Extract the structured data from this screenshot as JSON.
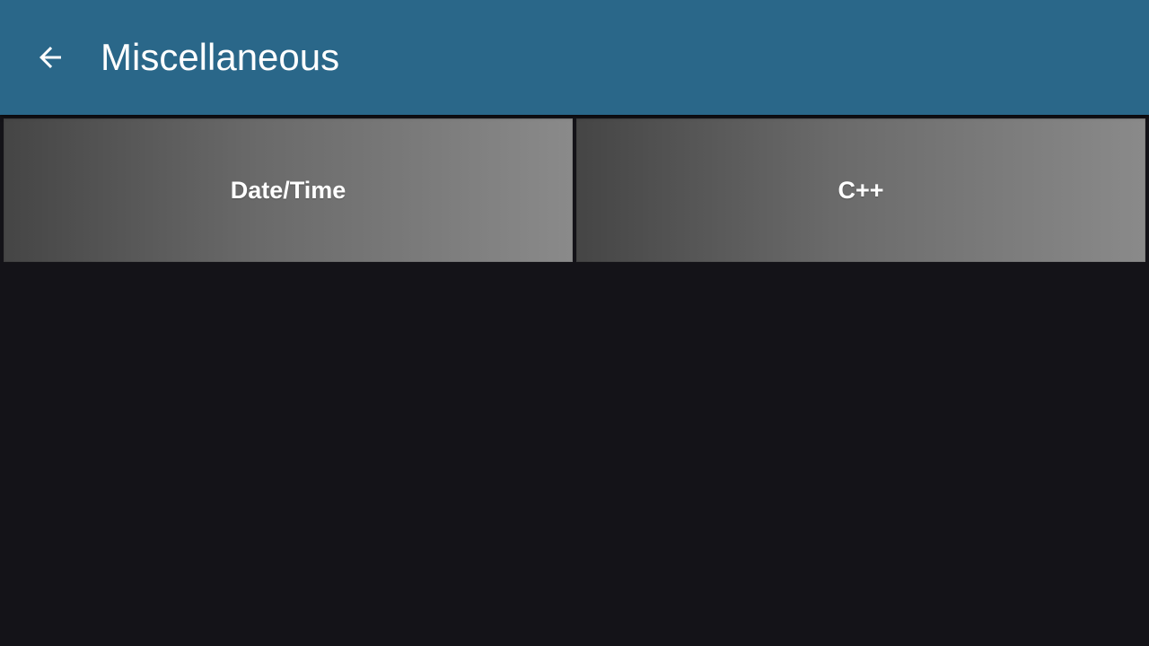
{
  "header": {
    "title": "Miscellaneous",
    "back_icon": "arrow-left-icon",
    "background_color": "#2a6789"
  },
  "tiles": [
    {
      "label": "Date/Time"
    },
    {
      "label": "C++"
    }
  ],
  "colors": {
    "page_background": "#141318",
    "tile_gradient_start": "#454545",
    "tile_gradient_end": "#8a8a8a",
    "text": "#ffffff"
  }
}
